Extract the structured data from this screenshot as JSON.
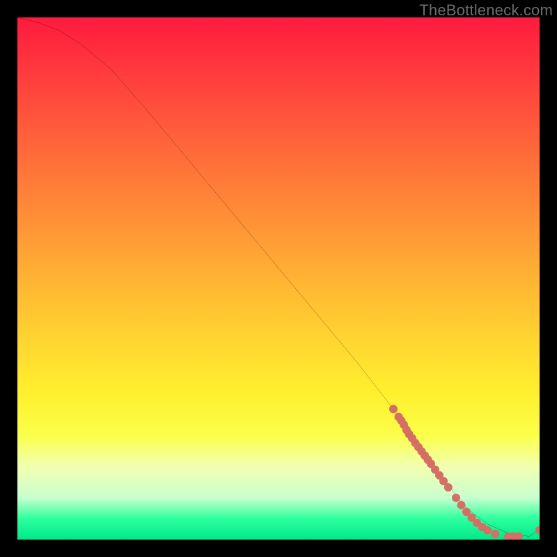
{
  "watermark": "TheBottleneck.com",
  "chart_data": {
    "type": "line",
    "title": "",
    "xlabel": "",
    "ylabel": "",
    "xlim": [
      0,
      100
    ],
    "ylim": [
      0,
      100
    ],
    "grid": false,
    "legend": false,
    "series": [
      {
        "name": "bottleneck-curve",
        "color": "#000000",
        "x": [
          0,
          4,
          8,
          12,
          18,
          25,
          35,
          45,
          55,
          65,
          72,
          78,
          82,
          86,
          90,
          94,
          98,
          100
        ],
        "y": [
          100,
          99,
          97.5,
          95,
          90,
          82,
          70,
          58,
          46,
          34,
          25,
          17,
          11,
          6,
          3,
          1.2,
          0.6,
          2
        ]
      }
    ],
    "points": {
      "name": "sample-points",
      "color": "#d56f64",
      "radius_px": 6,
      "x": [
        72,
        73,
        73.5,
        74,
        74.5,
        75,
        75.6,
        76.2,
        76.8,
        77.4,
        78,
        78.6,
        79.2,
        80,
        80.8,
        81.6,
        82.5,
        84,
        85,
        86,
        87,
        88,
        89,
        90,
        91.5,
        94,
        95,
        96,
        100
      ],
      "y": [
        25,
        23.5,
        22.8,
        22,
        21,
        20.2,
        19.4,
        18.5,
        17.7,
        16.9,
        16.1,
        15.3,
        14.5,
        13.4,
        12.3,
        11.2,
        10,
        8,
        6.6,
        5.3,
        4.2,
        3.2,
        2.4,
        1.8,
        1.1,
        0.6,
        0.6,
        0.6,
        1.8
      ]
    },
    "background": {
      "type": "vertical-gradient",
      "stops": [
        {
          "pos": 0.0,
          "color": "#ff1a3e"
        },
        {
          "pos": 0.26,
          "color": "#ff6a3a"
        },
        {
          "pos": 0.52,
          "color": "#ffb933"
        },
        {
          "pos": 0.72,
          "color": "#fff02e"
        },
        {
          "pos": 0.86,
          "color": "#f2ffb0"
        },
        {
          "pos": 0.96,
          "color": "#2dff9e"
        },
        {
          "pos": 1.0,
          "color": "#00e889"
        }
      ]
    }
  }
}
